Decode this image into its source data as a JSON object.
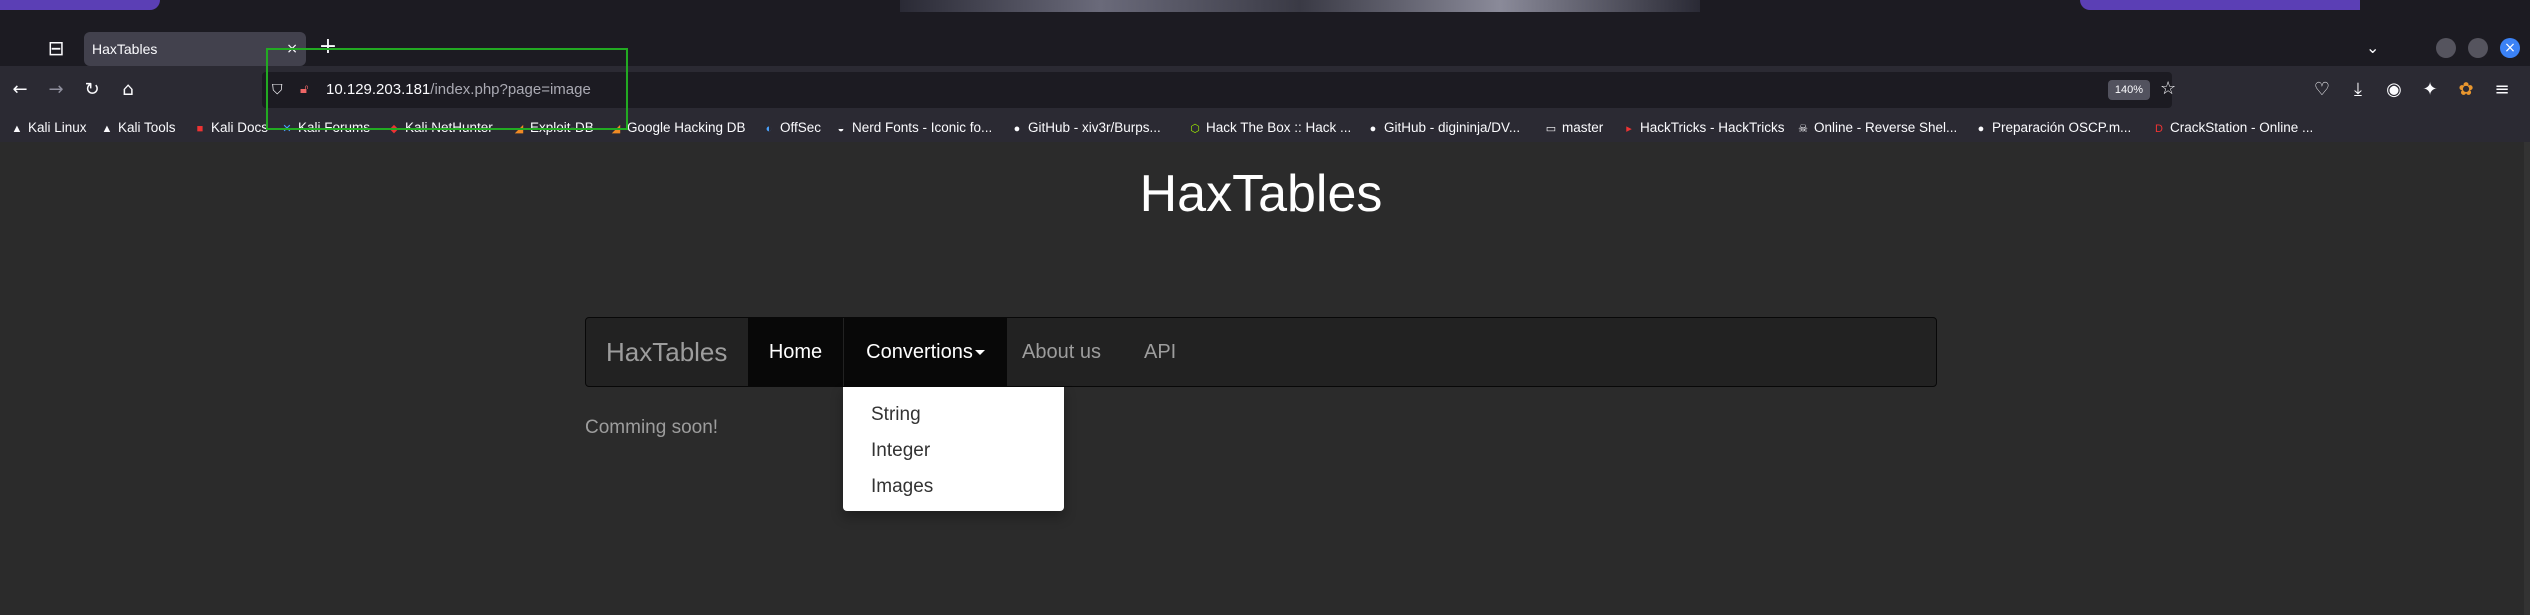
{
  "browser": {
    "tab": {
      "title": "HaxTables",
      "close": "×"
    },
    "new_tab": "+",
    "address": {
      "host": "10.129.203.181",
      "path": "/index.php?page=image"
    },
    "zoom": "140%",
    "bookmarks": [
      {
        "label": "Kali Linux",
        "icon": "kali-icon"
      },
      {
        "label": "Kali Tools",
        "icon": "kali-tools-icon"
      },
      {
        "label": "Kali Docs",
        "icon": "kali-docs-icon"
      },
      {
        "label": "Kali Forums",
        "icon": "kali-forums-icon"
      },
      {
        "label": "Kali NetHunter",
        "icon": "nethunter-icon"
      },
      {
        "label": "Exploit-DB",
        "icon": "exploitdb-icon"
      },
      {
        "label": "Google Hacking DB",
        "icon": "ghdb-icon"
      },
      {
        "label": "OffSec",
        "icon": "offsec-icon"
      },
      {
        "label": "Nerd Fonts - Iconic fo...",
        "icon": "nerdfonts-icon"
      },
      {
        "label": "GitHub - xiv3r/Burps...",
        "icon": "github-icon"
      },
      {
        "label": "Hack The Box :: Hack ...",
        "icon": "htb-icon"
      },
      {
        "label": "GitHub - digininja/DV...",
        "icon": "github-icon"
      },
      {
        "label": "master",
        "icon": "folder-icon"
      },
      {
        "label": "HackTricks - HackTricks",
        "icon": "hacktricks-icon"
      },
      {
        "label": "Online - Reverse Shel...",
        "icon": "skull-icon"
      },
      {
        "label": "Preparación OSCP.m...",
        "icon": "github-icon"
      },
      {
        "label": "CrackStation - Online ...",
        "icon": "crackstation-icon"
      }
    ]
  },
  "site": {
    "title": "HaxTables",
    "brand": "HaxTables",
    "nav": {
      "home": "Home",
      "convertions": "Convertions",
      "about": "About us",
      "api": "API"
    },
    "dropdown": [
      "String",
      "Integer",
      "Images"
    ],
    "message": "Comming soon!"
  }
}
